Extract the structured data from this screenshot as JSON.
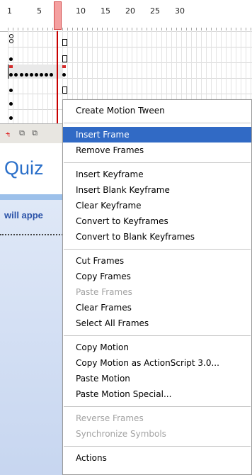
{
  "timeline": {
    "ruler_numbers": [
      "1",
      "5",
      "10",
      "15",
      "20",
      "25",
      "30"
    ]
  },
  "stage": {
    "title": "Quiz",
    "partial_text": "will appe"
  },
  "context_menu": {
    "highlight_color": "#316ac5",
    "groups": [
      [
        {
          "label": "Create Motion Tween",
          "enabled": true
        }
      ],
      [
        {
          "label": "Insert Frame",
          "enabled": true,
          "highlighted": true
        },
        {
          "label": "Remove Frames",
          "enabled": true
        }
      ],
      [
        {
          "label": "Insert Keyframe",
          "enabled": true
        },
        {
          "label": "Insert Blank Keyframe",
          "enabled": true
        },
        {
          "label": "Clear Keyframe",
          "enabled": true
        },
        {
          "label": "Convert to Keyframes",
          "enabled": true
        },
        {
          "label": "Convert to Blank Keyframes",
          "enabled": true
        }
      ],
      [
        {
          "label": "Cut Frames",
          "enabled": true
        },
        {
          "label": "Copy Frames",
          "enabled": true
        },
        {
          "label": "Paste Frames",
          "enabled": false
        },
        {
          "label": "Clear Frames",
          "enabled": true
        },
        {
          "label": "Select All Frames",
          "enabled": true
        }
      ],
      [
        {
          "label": "Copy Motion",
          "enabled": true
        },
        {
          "label": "Copy Motion as ActionScript 3.0...",
          "enabled": true
        },
        {
          "label": "Paste Motion",
          "enabled": true
        },
        {
          "label": "Paste Motion Special...",
          "enabled": true
        }
      ],
      [
        {
          "label": "Reverse Frames",
          "enabled": false
        },
        {
          "label": "Synchronize Symbols",
          "enabled": false
        }
      ],
      [
        {
          "label": "Actions",
          "enabled": true
        }
      ]
    ]
  }
}
